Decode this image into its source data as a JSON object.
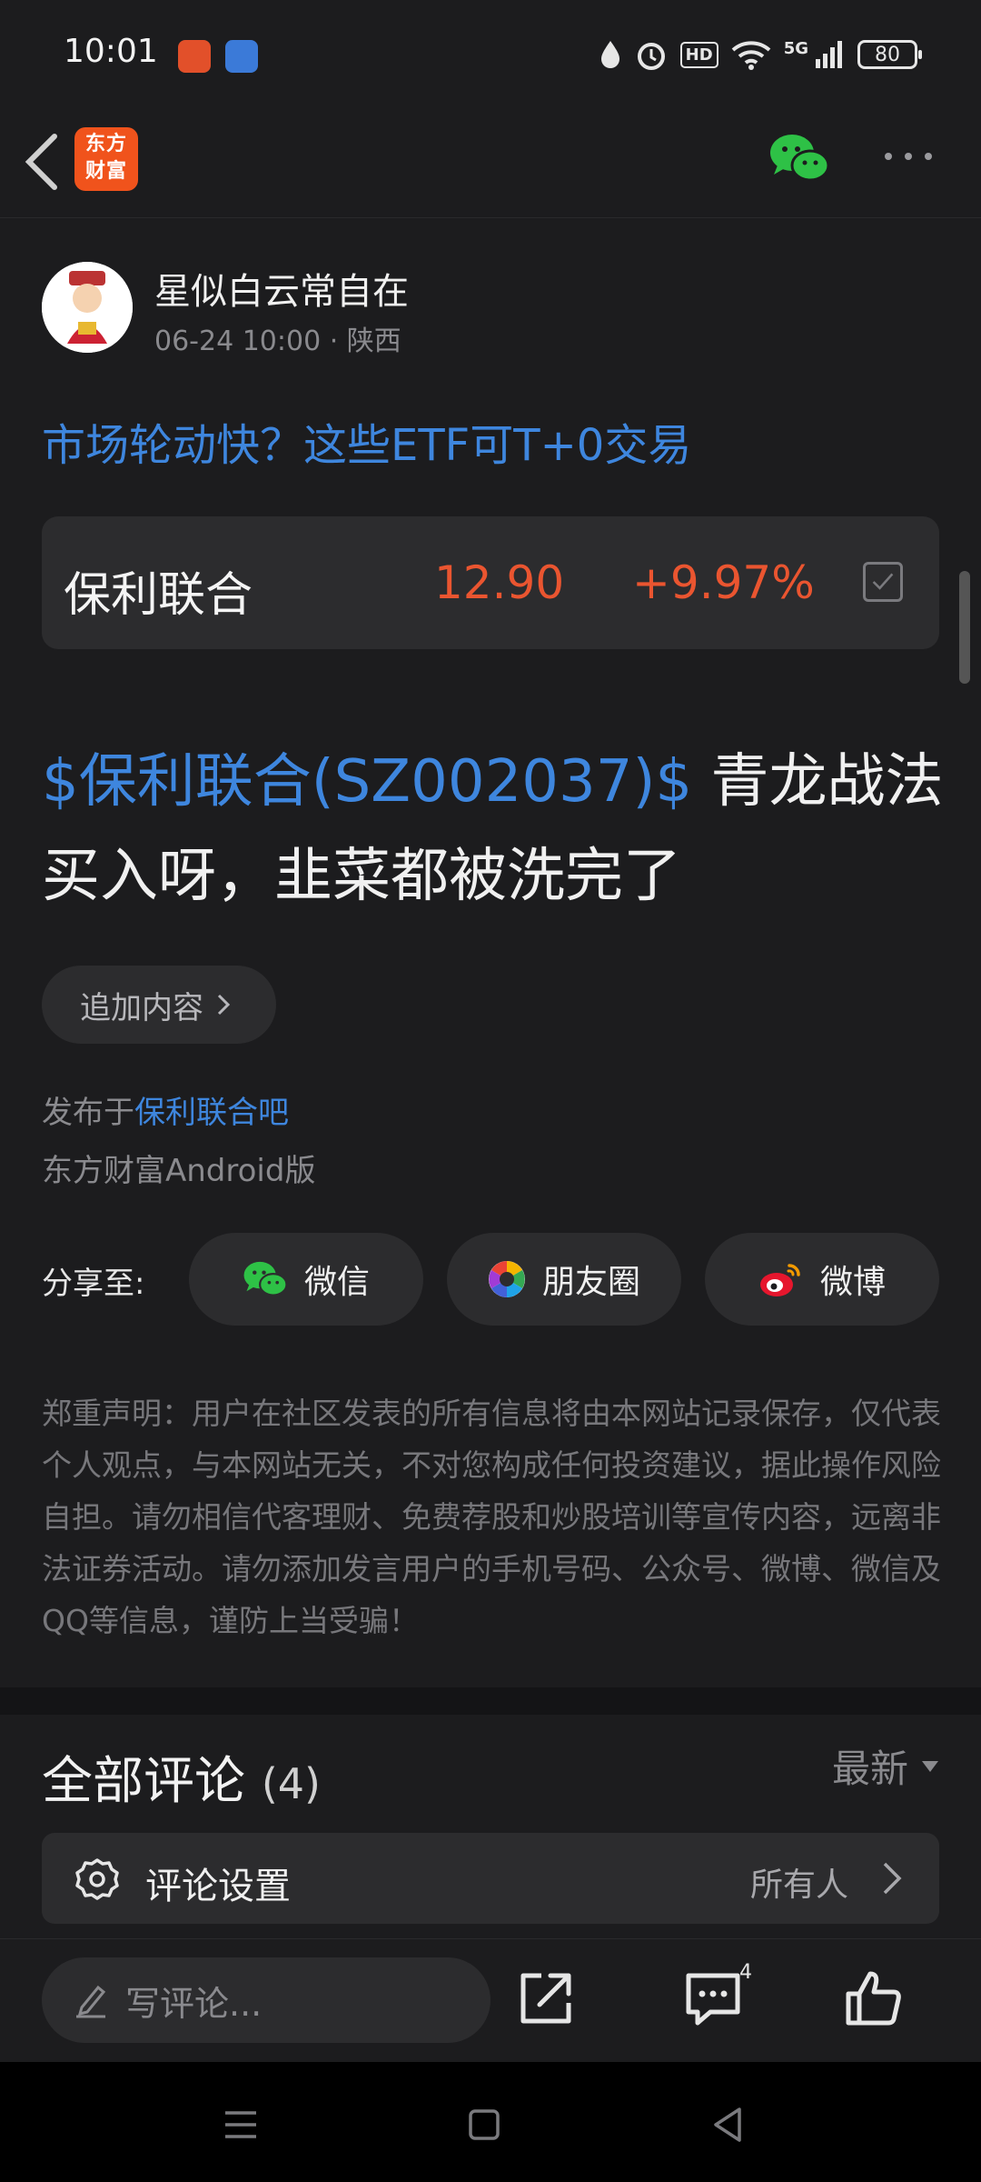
{
  "status_bar": {
    "time": "10:01",
    "network": "5G",
    "hd": "HD",
    "battery": "80"
  },
  "nav": {
    "logo_line1": "东方",
    "logo_line2": "财富"
  },
  "author": {
    "name": "星似白云常自在",
    "meta": "06-24 10:00 · 陕西"
  },
  "topic_link": "市场轮动快？这些ETF可T+0交易",
  "stock": {
    "name": "保利联合",
    "price": "12.90",
    "change": "+9.97%",
    "color": "#ea5530"
  },
  "post": {
    "stock_tag": "$保利联合(SZ002037)$",
    "text": " 青龙战法买入呀，韭菜都被洗完了"
  },
  "append_button": "追加内容",
  "published": {
    "prefix": "发布于",
    "bar_name": "保利联合吧"
  },
  "client": "东方财富Android版",
  "share": {
    "label": "分享至:",
    "wechat": "微信",
    "moments": "朋友圈",
    "weibo": "微博"
  },
  "disclaimer": "郑重声明：用户在社区发表的所有信息将由本网站记录保存，仅代表个人观点，与本网站无关，不对您构成任何投资建议，据此操作风险自担。请勿相信代客理财、免费荐股和炒股培训等宣传内容，远离非法证券活动。请勿添加发言用户的手机号码、公众号、微博、微信及QQ等信息，谨防上当受骗！",
  "comments": {
    "title": "全部评论",
    "count": "(4)",
    "sort": "最新",
    "settings_label": "评论设置",
    "settings_value": "所有人"
  },
  "bottom_bar": {
    "input_placeholder": "写评论...",
    "comment_badge": "4"
  },
  "colors": {
    "accent_blue": "#3e86de",
    "up_red": "#ea5530",
    "brand_orange": "#f0531c",
    "wechat_green": "#2ec146"
  }
}
